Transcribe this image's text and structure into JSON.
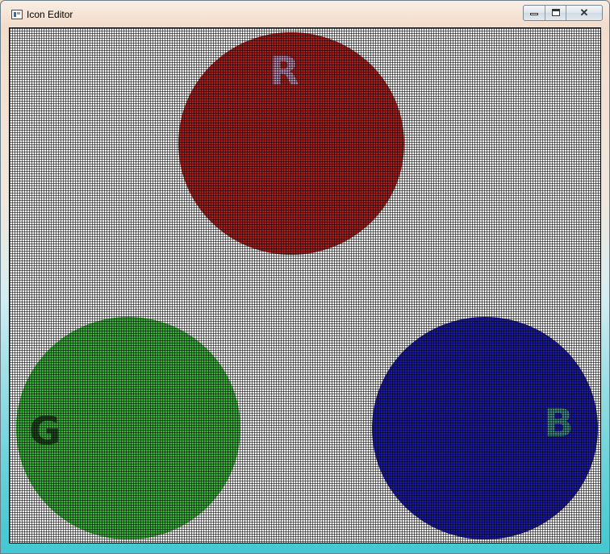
{
  "window": {
    "title": "Icon Editor",
    "buttons": {
      "minimize_icon": "minimize-icon",
      "maximize_icon": "maximize-icon",
      "close_icon": "close-icon",
      "close_glyph": "✕"
    }
  },
  "canvas": {
    "background": "#f4f4f4",
    "grid_color": "#000000",
    "circles": [
      {
        "name": "red-circle",
        "color": "#aa1f1f",
        "letter": "R",
        "letter_color": "#b98ab0"
      },
      {
        "name": "green-circle",
        "color": "#3cb33c",
        "letter": "G",
        "letter_color": "#1f4a1f"
      },
      {
        "name": "blue-circle",
        "color": "#1d1ba3",
        "letter": "B",
        "letter_color": "#3f8a86"
      }
    ]
  }
}
